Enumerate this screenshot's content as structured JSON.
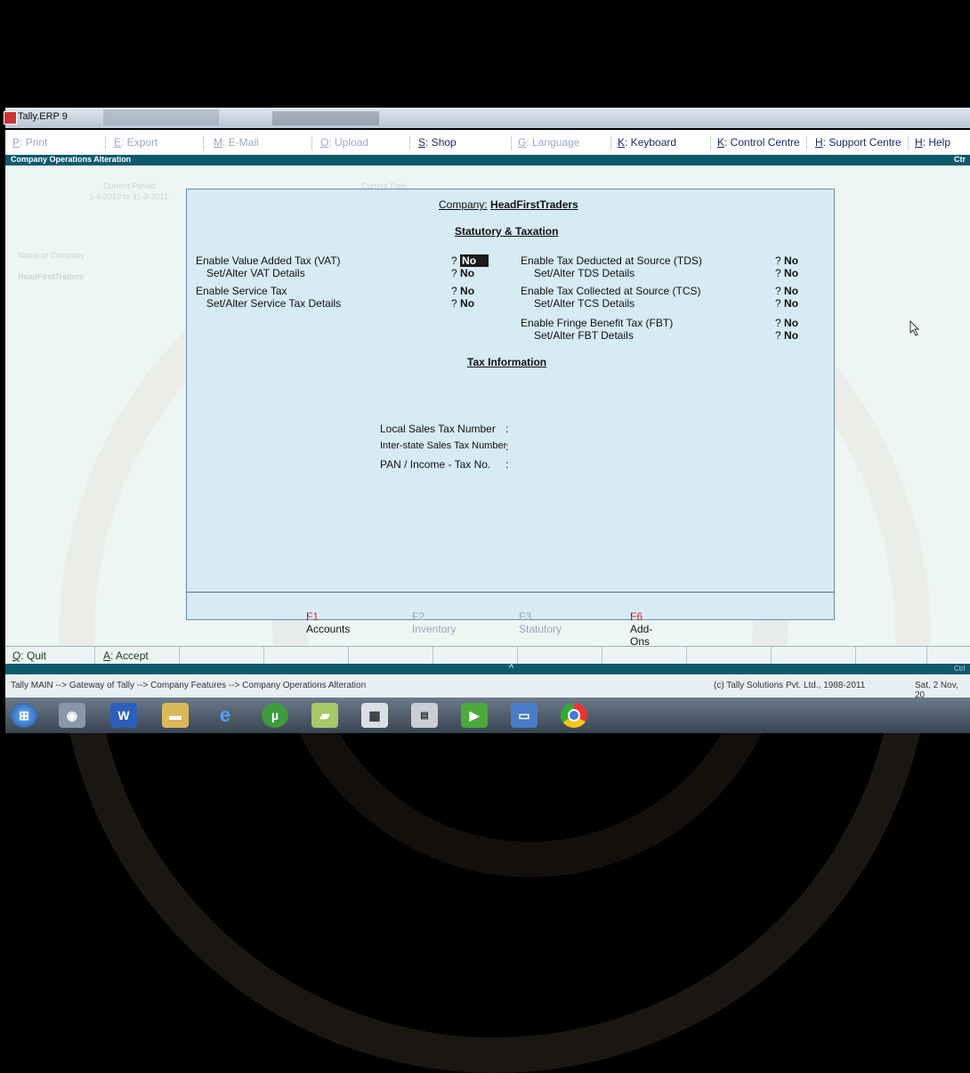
{
  "window": {
    "title": "Tally.ERP 9"
  },
  "topbar": {
    "buttons": [
      {
        "key": "P",
        "label": ": Print"
      },
      {
        "key": "E",
        "label": ": Export"
      },
      {
        "key": "M",
        "label": ": E-Mail"
      },
      {
        "key": "O",
        "label": ": Upload"
      },
      {
        "key": "S",
        "label": ": Shop"
      },
      {
        "key": "G",
        "label": ": Language"
      },
      {
        "key": "K",
        "label": ": Keyboard"
      },
      {
        "key": "K",
        "label": ": Control Centre"
      },
      {
        "key": "H",
        "label": ": Support Centre"
      },
      {
        "key": "H",
        "label": ": Help"
      }
    ]
  },
  "header": {
    "title": "Company Operations  Alteration",
    "right": "Ctr"
  },
  "left_ghost": {
    "period_label": "Current Period",
    "period_value": "1-4-2010 to 31-3-2011",
    "date_label": "Current Date",
    "company_label": "Name of Company",
    "company_value": "HeadFirstTraders"
  },
  "panel": {
    "company_label": "Company:",
    "company_name": "HeadFirstTraders",
    "section_title": "Statutory & Taxation",
    "left_fields": [
      {
        "label": "Enable Value Added Tax (VAT)",
        "q": "?",
        "value": "No"
      },
      {
        "label": "Set/Alter VAT Details",
        "q": "?",
        "value": "No"
      },
      {
        "label": "Enable Service Tax",
        "q": "?",
        "value": "No"
      },
      {
        "label": "Set/Alter Service Tax Details",
        "q": "?",
        "value": "No"
      }
    ],
    "right_fields": [
      {
        "label": "Enable Tax Deducted at Source (TDS)",
        "q": "?",
        "value": "No"
      },
      {
        "label": "Set/Alter TDS Details",
        "q": "?",
        "value": "No"
      },
      {
        "label": "Enable Tax Collected at Source (TCS)",
        "q": "?",
        "value": "No"
      },
      {
        "label": "Set/Alter TCS Details",
        "q": "?",
        "value": "No"
      },
      {
        "label": "Enable Fringe Benefit Tax (FBT)",
        "q": "?",
        "value": "No"
      },
      {
        "label": "Set/Alter FBT Details",
        "q": "?",
        "value": "No"
      }
    ],
    "tax_info_title": "Tax Information",
    "tax_info": [
      {
        "label": "Local Sales Tax Number",
        "sep": ":"
      },
      {
        "label": "Inter-state Sales Tax Number",
        "sep": ":"
      },
      {
        "label": "PAN / Income - Tax No.",
        "sep": ":"
      }
    ],
    "fkeys": [
      {
        "key": "F1",
        "label": ": Accounts"
      },
      {
        "key": "F2",
        "label": ": Inventory"
      },
      {
        "key": "F3",
        "label": ": Statutory"
      },
      {
        "key": "F6",
        "label": ": Add-Ons"
      }
    ]
  },
  "bottombar": {
    "quit_key": "Q",
    "quit_label": ": Quit",
    "accept_key": "A",
    "accept_label": ": Accept"
  },
  "nav": {
    "caret": "^",
    "right": "Ctrl"
  },
  "status": {
    "path": "Tally MAIN --> Gateway of Tally --> Company Features --> Company Operations  Alteration",
    "copyright": "(c) Tally Solutions Pvt. Ltd., 1988-2011",
    "date": "Sat, 2 Nov, 20"
  },
  "taskbar": {
    "icons": [
      "start-orb",
      "disk-icon",
      "word-icon",
      "folder-icon",
      "ie-icon",
      "utorrent-icon",
      "notes-icon",
      "calculator-icon",
      "tally-icon",
      "camera-icon",
      "screen-icon",
      "chrome-icon"
    ]
  },
  "colors": {
    "header_strip": "#0e5a6d",
    "panel_bg": "#d7ebf5",
    "accent_red": "#d22",
    "hotkey_text": "#1f2a66"
  }
}
